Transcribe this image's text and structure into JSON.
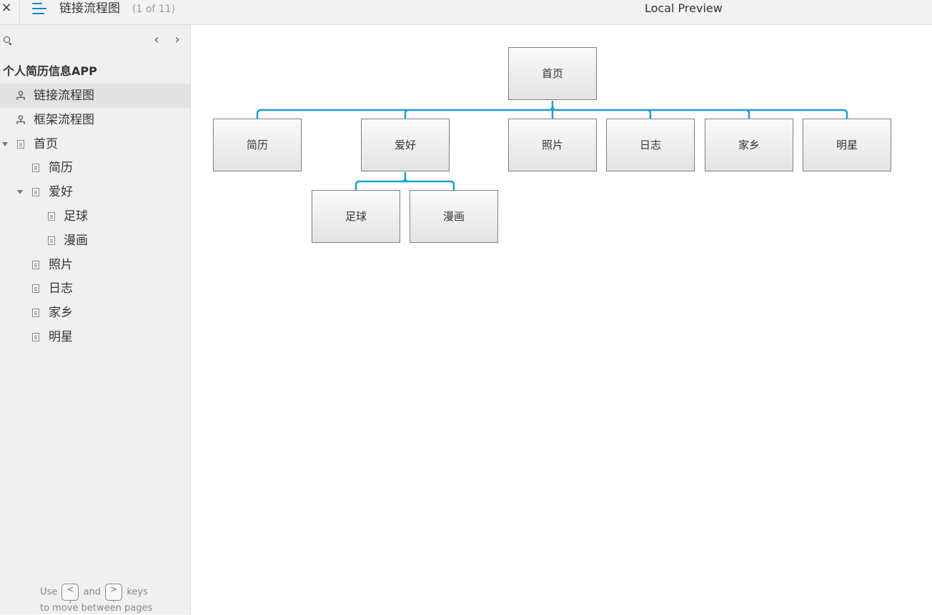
{
  "topbar": {
    "close_icon": "close-icon",
    "menu_icon": "menu-icon",
    "page_title": "链接流程图",
    "page_count": "(1 of 11)",
    "preview_title": "Local Preview"
  },
  "sidebar": {
    "search_icon": "search-icon",
    "prev_label": "‹",
    "next_label": "›",
    "project_name": "个人简历信息APP",
    "items": [
      {
        "label": "链接流程图",
        "icon": "flowchart-icon",
        "selected": true
      },
      {
        "label": "框架流程图",
        "icon": "flowchart-icon",
        "selected": false
      },
      {
        "label": "首页",
        "icon": "page-icon",
        "expanded": true
      },
      {
        "label": "简历",
        "icon": "page-icon"
      },
      {
        "label": "爱好",
        "icon": "page-icon",
        "expanded": true
      },
      {
        "label": "足球",
        "icon": "page-icon"
      },
      {
        "label": "漫画",
        "icon": "page-icon"
      },
      {
        "label": "照片",
        "icon": "page-icon"
      },
      {
        "label": "日志",
        "icon": "page-icon"
      },
      {
        "label": "家乡",
        "icon": "page-icon"
      },
      {
        "label": "明星",
        "icon": "page-icon"
      }
    ],
    "hint": {
      "use": "Use",
      "key_prev": "<\n,",
      "and": "and",
      "key_next": ">\n.",
      "keys": "keys",
      "line2": "to move between pages"
    }
  },
  "diagram": {
    "connector_color": "#1a9fd1",
    "nodes": {
      "home": "首页",
      "resume": "简历",
      "hobby": "爱好",
      "photo": "照片",
      "diary": "日志",
      "hometown": "家乡",
      "star": "明星",
      "football": "足球",
      "comic": "漫画"
    }
  }
}
